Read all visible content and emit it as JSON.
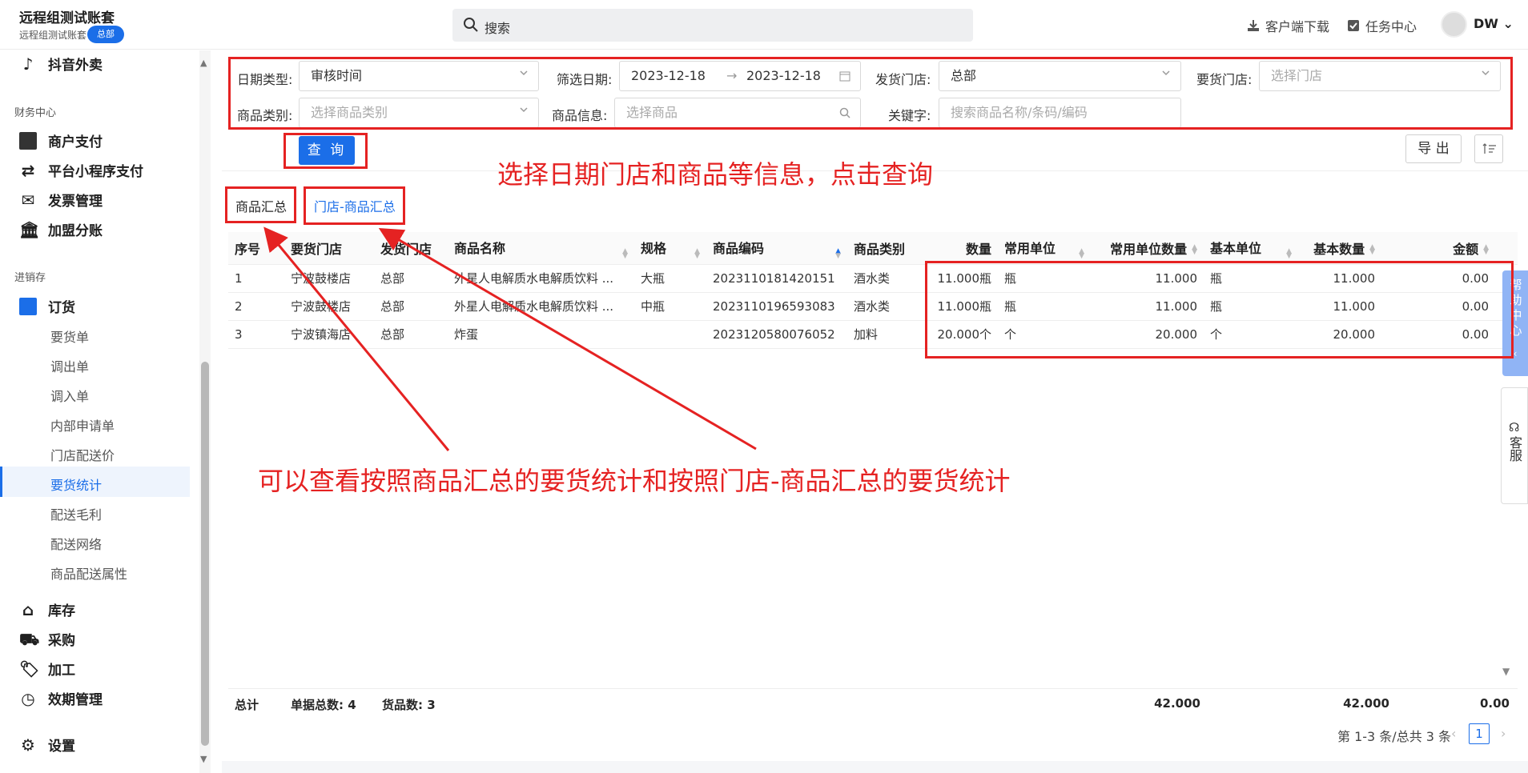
{
  "header": {
    "title": "远程组测试账套",
    "subtitle": "远程组测试账套",
    "badge": "总部",
    "search_placeholder": "搜索",
    "download_label": "客户端下载",
    "tasks_label": "任务中心",
    "user": "DW"
  },
  "sidebar": {
    "top_item": "抖音外卖",
    "section_finance": "财务中心",
    "finance_items": [
      "商户支付",
      "平台小程序支付",
      "发票管理",
      "加盟分账"
    ],
    "section_inventory": "进销存",
    "order_group": "订货",
    "order_items": [
      "要货单",
      "调出单",
      "调入单",
      "内部申请单",
      "门店配送价",
      "要货统计",
      "配送毛利",
      "配送网络",
      "商品配送属性"
    ],
    "active_item": "要货统计",
    "bottom_items": [
      "库存",
      "采购",
      "加工",
      "效期管理"
    ],
    "settings": "设置"
  },
  "filters": {
    "date_type_label": "日期类型:",
    "date_type_value": "审核时间",
    "filter_date_label": "筛选日期:",
    "date_start": "2023-12-18",
    "date_arrow": "→",
    "date_end": "2023-12-18",
    "ship_store_label": "发货门店:",
    "ship_store_value": "总部",
    "req_store_label": "要货门店:",
    "req_store_placeholder": "选择门店",
    "category_label": "商品类别:",
    "category_placeholder": "选择商品类别",
    "goods_info_label": "商品信息:",
    "goods_info_placeholder": "选择商品",
    "keyword_label": "关键字:",
    "keyword_placeholder": "搜索商品名称/条码/编码",
    "query_button": "查 询",
    "export_button": "导 出"
  },
  "tabs": [
    "商品汇总",
    "门店-商品汇总"
  ],
  "table": {
    "columns": [
      "序号",
      "要货门店",
      "发货门店",
      "商品名称",
      "规格",
      "商品编码",
      "商品类别",
      "数量",
      "常用单位",
      "常用单位数量",
      "基本单位",
      "基本数量",
      "金额"
    ],
    "rows": [
      [
        "1",
        "宁波鼓楼店",
        "总部",
        "外星人电解质水电解质饮料 ...",
        "大瓶",
        "2023110181420151",
        "酒水类",
        "11.000瓶",
        "瓶",
        "11.000",
        "瓶",
        "11.000",
        "0.00"
      ],
      [
        "2",
        "宁波鼓楼店",
        "总部",
        "外星人电解质水电解质饮料 ...",
        "中瓶",
        "2023110196593083",
        "酒水类",
        "11.000瓶",
        "瓶",
        "11.000",
        "瓶",
        "11.000",
        "0.00"
      ],
      [
        "3",
        "宁波镇海店",
        "总部",
        "炸蛋",
        "",
        "2023120580076052",
        "加料",
        "20.000个",
        "个",
        "20.000",
        "个",
        "20.000",
        "0.00"
      ]
    ],
    "footer": {
      "total_label": "总计",
      "doc_count_label": "单据总数: 4",
      "goods_count_label": "货品数: 3",
      "common_qty_total": "42.000",
      "base_qty_total": "42.000",
      "amount_total": "0.00"
    }
  },
  "pagination": {
    "summary": "第 1-3 条/总共 3 条",
    "current_page": "1"
  },
  "side_widgets": {
    "help": "帮助中心",
    "service": "客服"
  },
  "annotations": {
    "top_note": "选择日期门店和商品等信息，点击查询",
    "bottom_note": "可以查看按照商品汇总的要货统计和按照门店-商品汇总的要货统计"
  },
  "colors": {
    "accent": "#1b6ee8",
    "annotation_red": "#e52222"
  }
}
